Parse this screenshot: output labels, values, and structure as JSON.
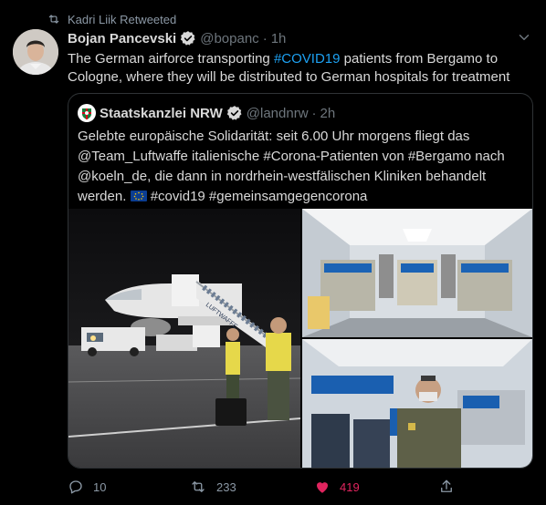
{
  "retweet_header": {
    "text": "Kadri Liik Retweeted"
  },
  "tweet": {
    "author_name": "Bojan Pancevski",
    "author_handle": "@bopanc",
    "separator": "·",
    "time": "1h",
    "text_before_link": "The German airforce transporting ",
    "hashtag": "#COVID19",
    "text_after_link": " patients from Bergamo to Cologne, where they will be distributed to German hospitals for treatment"
  },
  "quoted": {
    "author_name": "Staatskanzlei NRW",
    "author_handle": "@landnrw",
    "separator": "·",
    "time": "2h",
    "text_line_1": "Gelebte europäische Solidarität: seit 6.00 Uhr morgens fliegt das",
    "text_line_2": "@Team_Luftwaffe italienische #Corona-Patienten von #Bergamo nach",
    "text_line_3": "@koeln_de, die dann in nordrhein-westfälischen Kliniken behandelt",
    "text_line_4a": "werden. ",
    "text_line_4b": " #covid19 #gemeinsamgegencorona",
    "aircraft_text": "LUFTWAFFE"
  },
  "actions": {
    "reply_count": "10",
    "retweet_count": "233",
    "like_count": "419"
  },
  "colors": {
    "background": "#000000",
    "link": "#1da1f2",
    "like": "#e0245e",
    "muted": "#8b98a5",
    "border": "#2f3336"
  },
  "icons": [
    "retweet-icon",
    "verified-badge-icon",
    "chevron-down-icon",
    "reply-icon",
    "like-icon",
    "share-icon",
    "eu-flag-icon"
  ]
}
